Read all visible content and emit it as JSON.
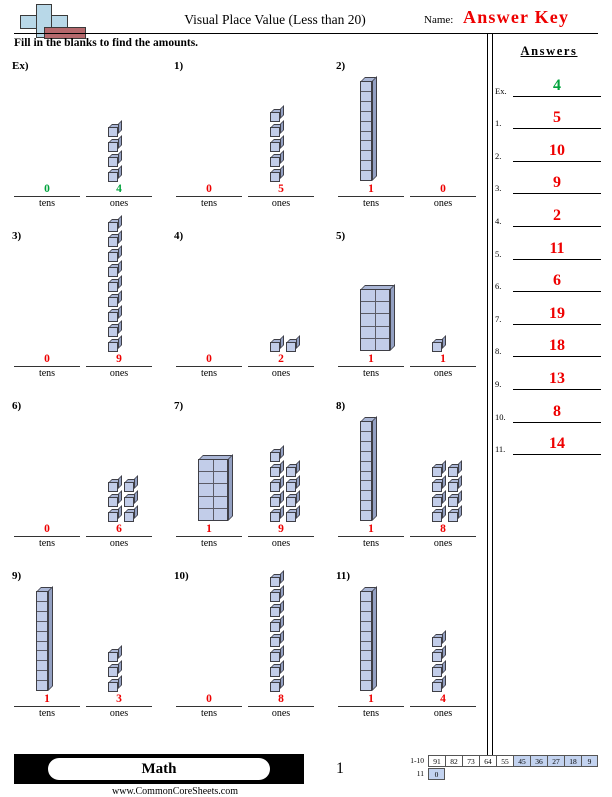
{
  "header": {
    "title": "Visual Place Value (Less than 20)",
    "name_label": "Name:",
    "answer_key": "Answer Key",
    "instructions": "Fill in the blanks to find the amounts.",
    "logo_icon": "plus-block-logo"
  },
  "answers_panel": {
    "heading": "Answers",
    "rows": [
      {
        "num": "Ex.",
        "value": "4",
        "color": "#00a33c"
      },
      {
        "num": "1.",
        "value": "5",
        "color": "#ee0000"
      },
      {
        "num": "2.",
        "value": "10",
        "color": "#ee0000"
      },
      {
        "num": "3.",
        "value": "9",
        "color": "#ee0000"
      },
      {
        "num": "4.",
        "value": "2",
        "color": "#ee0000"
      },
      {
        "num": "5.",
        "value": "11",
        "color": "#ee0000"
      },
      {
        "num": "6.",
        "value": "6",
        "color": "#ee0000"
      },
      {
        "num": "7.",
        "value": "19",
        "color": "#ee0000"
      },
      {
        "num": "8.",
        "value": "18",
        "color": "#ee0000"
      },
      {
        "num": "9.",
        "value": "13",
        "color": "#ee0000"
      },
      {
        "num": "10.",
        "value": "8",
        "color": "#ee0000"
      },
      {
        "num": "11.",
        "value": "14",
        "color": "#ee0000"
      }
    ]
  },
  "labels": {
    "tens": "tens",
    "ones": "ones"
  },
  "problems": [
    {
      "label": "Ex)",
      "tens": "0",
      "ones": "4",
      "tens_blocks": 0,
      "ones_blocks": 4,
      "ones_shape": "column",
      "answer_color": "#00a33c",
      "tens_shape": "none"
    },
    {
      "label": "1)",
      "tens": "0",
      "ones": "5",
      "tens_blocks": 0,
      "ones_blocks": 5,
      "ones_shape": "column",
      "answer_color": "#ee0000",
      "tens_shape": "none"
    },
    {
      "label": "2)",
      "tens": "1",
      "ones": "0",
      "tens_blocks": 1,
      "ones_blocks": 0,
      "ones_shape": "column",
      "answer_color": "#ee0000",
      "tens_shape": "rod"
    },
    {
      "label": "3)",
      "tens": "0",
      "ones": "9",
      "tens_blocks": 0,
      "ones_blocks": 9,
      "ones_shape": "column",
      "answer_color": "#ee0000",
      "tens_shape": "none"
    },
    {
      "label": "4)",
      "tens": "0",
      "ones": "2",
      "tens_blocks": 0,
      "ones_blocks": 2,
      "ones_shape": "pair",
      "answer_color": "#ee0000",
      "tens_shape": "none"
    },
    {
      "label": "5)",
      "tens": "1",
      "ones": "1",
      "tens_blocks": 1,
      "ones_blocks": 1,
      "ones_shape": "column",
      "answer_color": "#ee0000",
      "tens_shape": "flat"
    },
    {
      "label": "6)",
      "tens": "0",
      "ones": "6",
      "tens_blocks": 0,
      "ones_blocks": 6,
      "ones_shape": "pair",
      "answer_color": "#ee0000",
      "tens_shape": "none"
    },
    {
      "label": "7)",
      "tens": "1",
      "ones": "9",
      "tens_blocks": 1,
      "ones_blocks": 9,
      "ones_shape": "pair",
      "answer_color": "#ee0000",
      "tens_shape": "flat"
    },
    {
      "label": "8)",
      "tens": "1",
      "ones": "8",
      "tens_blocks": 1,
      "ones_blocks": 8,
      "ones_shape": "pair",
      "answer_color": "#ee0000",
      "tens_shape": "rod"
    },
    {
      "label": "9)",
      "tens": "1",
      "ones": "3",
      "tens_blocks": 1,
      "ones_blocks": 3,
      "ones_shape": "column",
      "answer_color": "#ee0000",
      "tens_shape": "rod"
    },
    {
      "label": "10)",
      "tens": "0",
      "ones": "8",
      "tens_blocks": 0,
      "ones_blocks": 8,
      "ones_shape": "column",
      "answer_color": "#ee0000",
      "tens_shape": "none"
    },
    {
      "label": "11)",
      "tens": "1",
      "ones": "4",
      "tens_blocks": 1,
      "ones_blocks": 4,
      "ones_shape": "column",
      "answer_color": "#ee0000",
      "tens_shape": "rod"
    }
  ],
  "footer": {
    "subject": "Math",
    "website": "www.CommonCoreSheets.com",
    "page_number": "1",
    "scale": {
      "row1_label": "1-10",
      "row1_values": [
        "91",
        "82",
        "73",
        "64",
        "55",
        "45",
        "36",
        "27",
        "18",
        "9"
      ],
      "row1_highlight": [
        false,
        false,
        false,
        false,
        false,
        true,
        true,
        true,
        true,
        true
      ],
      "row2_label": "11",
      "row2_values": [
        "0"
      ],
      "row2_highlight": [
        true
      ],
      "highlight_color": "#c3d3f0"
    }
  }
}
